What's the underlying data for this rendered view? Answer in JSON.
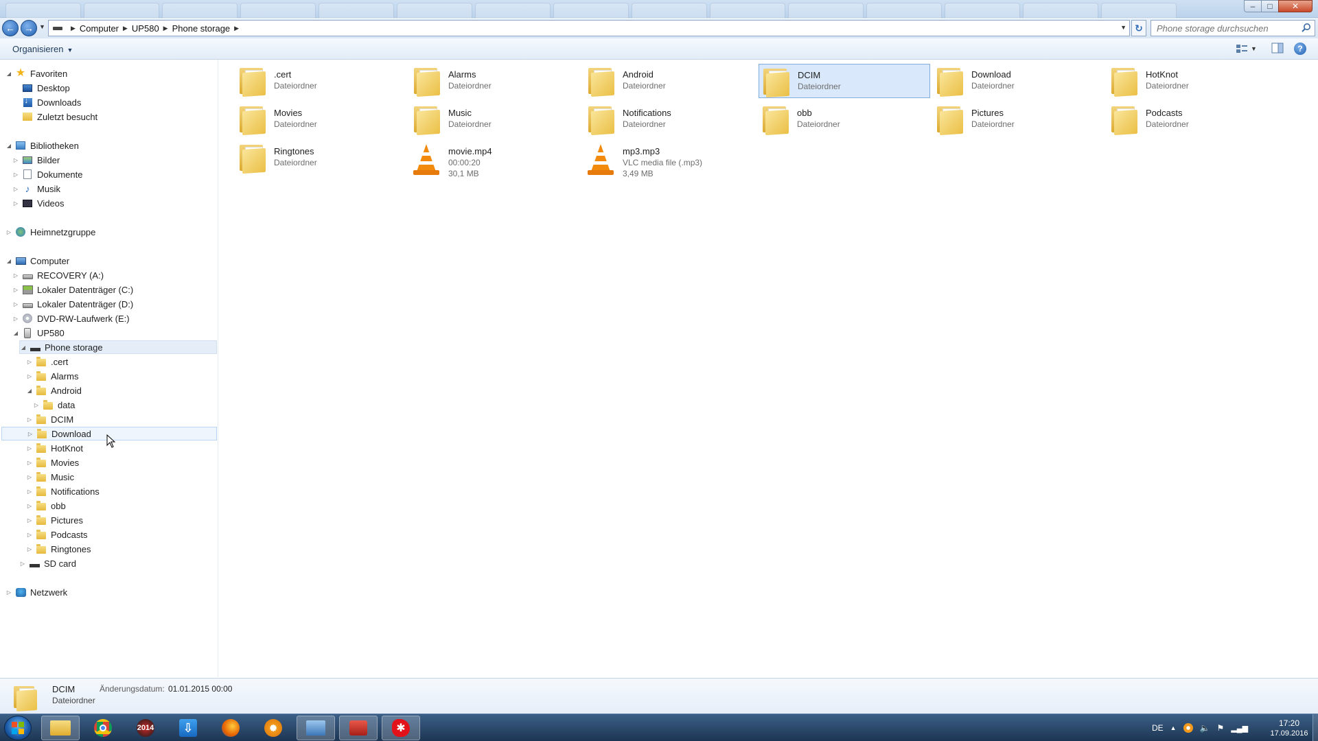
{
  "address": {
    "crumbs": [
      "Computer",
      "UP580",
      "Phone storage"
    ],
    "search_placeholder": "Phone storage durchsuchen"
  },
  "toolbar": {
    "organize_label": "Organisieren"
  },
  "sidebar": {
    "favorites": {
      "label": "Favoriten",
      "items": [
        "Desktop",
        "Downloads",
        "Zuletzt besucht"
      ]
    },
    "libraries": {
      "label": "Bibliotheken",
      "items": [
        "Bilder",
        "Dokumente",
        "Musik",
        "Videos"
      ]
    },
    "homegroup": "Heimnetzgruppe",
    "computer": {
      "label": "Computer",
      "drives": [
        "RECOVERY (A:)",
        "Lokaler Datenträger (C:)",
        "Lokaler Datenträger (D:)",
        "DVD-RW-Laufwerk (E:)"
      ],
      "device": "UP580",
      "storage": "Phone storage",
      "storage_folders": [
        ".cert",
        "Alarms",
        "Android",
        "data",
        "DCIM",
        "Download",
        "HotKnot",
        "Movies",
        "Music",
        "Notifications",
        "obb",
        "Pictures",
        "Podcasts",
        "Ringtones"
      ],
      "sdcard": "SD card"
    },
    "network": "Netzwerk"
  },
  "content": {
    "items": [
      {
        "name": ".cert",
        "sub1": "Dateiordner",
        "sub2": "",
        "kind": "folder"
      },
      {
        "name": "Alarms",
        "sub1": "Dateiordner",
        "sub2": "",
        "kind": "folder"
      },
      {
        "name": "Android",
        "sub1": "Dateiordner",
        "sub2": "",
        "kind": "folder"
      },
      {
        "name": "DCIM",
        "sub1": "Dateiordner",
        "sub2": "",
        "kind": "folder"
      },
      {
        "name": "Download",
        "sub1": "Dateiordner",
        "sub2": "",
        "kind": "folder"
      },
      {
        "name": "HotKnot",
        "sub1": "Dateiordner",
        "sub2": "",
        "kind": "folder"
      },
      {
        "name": "Movies",
        "sub1": "Dateiordner",
        "sub2": "",
        "kind": "folder"
      },
      {
        "name": "Music",
        "sub1": "Dateiordner",
        "sub2": "",
        "kind": "folder"
      },
      {
        "name": "Notifications",
        "sub1": "Dateiordner",
        "sub2": "",
        "kind": "folder"
      },
      {
        "name": "obb",
        "sub1": "Dateiordner",
        "sub2": "",
        "kind": "folder"
      },
      {
        "name": "Pictures",
        "sub1": "Dateiordner",
        "sub2": "",
        "kind": "folder"
      },
      {
        "name": "Podcasts",
        "sub1": "Dateiordner",
        "sub2": "",
        "kind": "folder"
      },
      {
        "name": "Ringtones",
        "sub1": "Dateiordner",
        "sub2": "",
        "kind": "folder"
      },
      {
        "name": "movie.mp4",
        "sub1": "00:00:20",
        "sub2": "30,1 MB",
        "kind": "vlc"
      },
      {
        "name": "mp3.mp3",
        "sub1": "VLC media file (.mp3)",
        "sub2": "3,49 MB",
        "kind": "vlc"
      }
    ],
    "selected": "DCIM"
  },
  "details": {
    "name": "DCIM",
    "type": "Dateiordner",
    "date_label": "Änderungsdatum:",
    "date_value": "01.01.2015 00:00"
  },
  "taskbar": {
    "apps": [
      "explorer-icon",
      "chrome-icon",
      "calendar-app-icon",
      "download-manager-icon",
      "firefox-icon",
      "settings-app-icon",
      "control-panel-icon",
      "toolbox-icon",
      "paint-splash-icon"
    ],
    "app_2014_label": "2014",
    "lang": "DE",
    "time": "17:20",
    "date": "17.09.2016"
  },
  "colors": {
    "selection": "#d9e8fb",
    "folder": "#eabf45",
    "vlc_orange": "#f28a0e",
    "taskbar": "#1d3553"
  }
}
